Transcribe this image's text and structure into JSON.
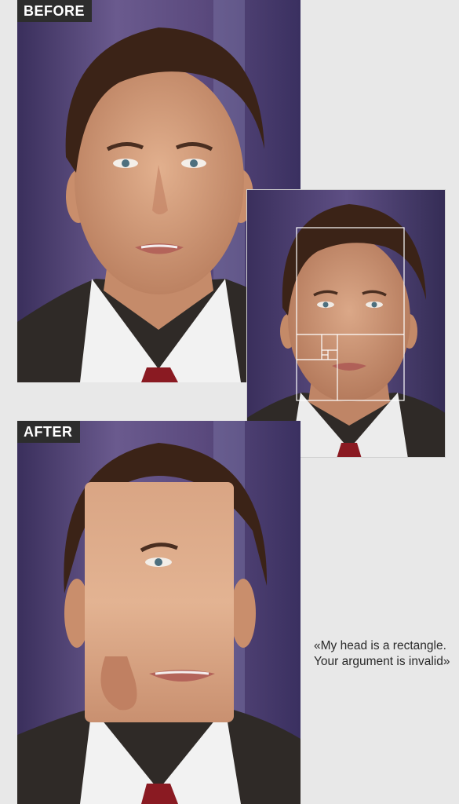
{
  "labels": {
    "before": "BEFORE",
    "after": "AFTER"
  },
  "quote": {
    "line1": "«My head is a rectangle.",
    "line2": "Your argument is invalid»"
  },
  "colors": {
    "page_background": "#e8e8e8",
    "tag_background": "#2d2d2d",
    "tag_text": "#ffffff",
    "backdrop_purple": "#4a3f6e",
    "skin": "#d49a78",
    "hair": "#3b2317",
    "suit": "#2f2a27",
    "shirt": "#f2f2f2",
    "tie": "#8a1a22",
    "grid_lines": "#ffffff"
  },
  "icons": [
    "portrait-before-image",
    "portrait-golden-ratio-image",
    "portrait-after-image"
  ]
}
